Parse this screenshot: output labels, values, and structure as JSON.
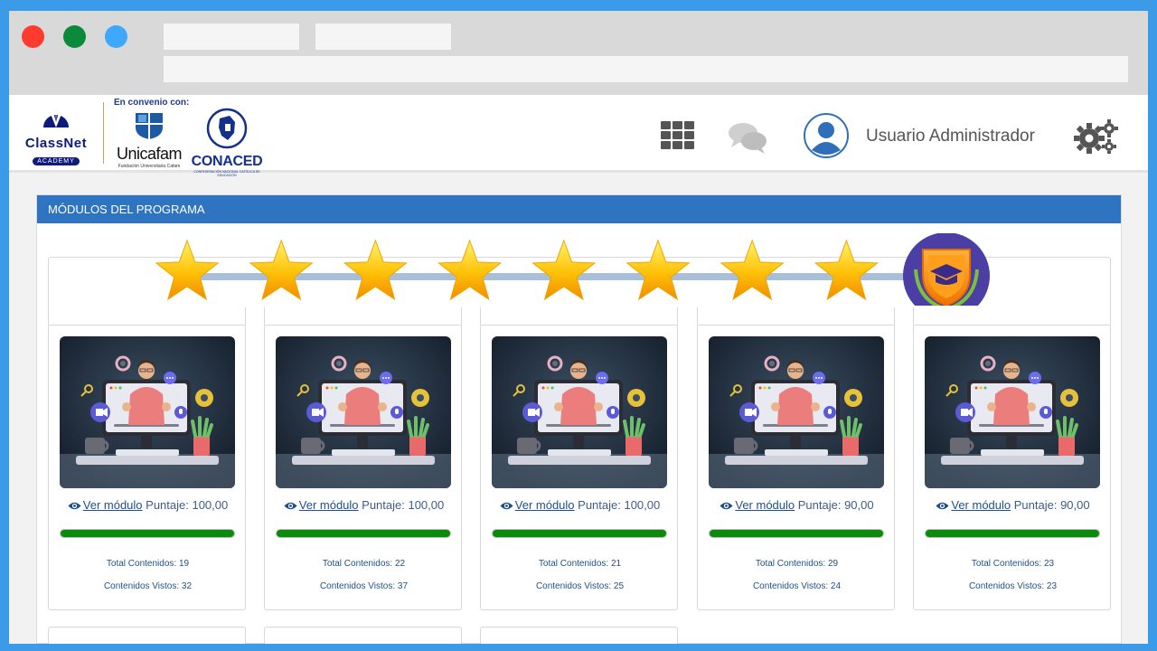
{
  "header": {
    "classnet_name": "ClassNet",
    "classnet_sub": "ACADEMY",
    "convenio": "En convenio con:",
    "unicafam_name": "Unicafam",
    "unicafam_sub": "Fundación Universitaria Cafam",
    "conaced_name": "CONACED",
    "conaced_sub": "CONFEDERACIÓN NACIONAL CATÓLICA DE EDUCACIÓN",
    "user_name": "Usuario Administrador",
    "icons": [
      "apps-grid-icon",
      "chat-icon",
      "user-avatar-icon",
      "settings-gears-icon"
    ]
  },
  "panel": {
    "title": "MÓDULOS DEL PROGRAMA",
    "progress": {
      "stars_earned": 8,
      "final_badge": "graduation-shield-icon"
    }
  },
  "colors": {
    "accent": "#2f74c0",
    "progress": "#0c8a0c",
    "link": "#1d4f91",
    "frame": "#3c9be8"
  },
  "modules": [
    {
      "link": "Ver módulo",
      "score": "Puntaje: 100,00",
      "progress": 1.0,
      "total": "Total Contenidos: 19",
      "seen": "Contenidos Vistos: 32"
    },
    {
      "link": "Ver módulo",
      "score": "Puntaje: 100,00",
      "progress": 1.0,
      "total": "Total Contenidos: 22",
      "seen": "Contenidos Vistos: 37"
    },
    {
      "link": "Ver módulo",
      "score": "Puntaje: 100,00",
      "progress": 1.0,
      "total": "Total Contenidos: 21",
      "seen": "Contenidos Vistos: 25"
    },
    {
      "link": "Ver módulo",
      "score": "Puntaje: 90,00",
      "progress": 1.0,
      "total": "Total Contenidos: 29",
      "seen": "Contenidos Vistos: 24"
    },
    {
      "link": "Ver módulo",
      "score": "Puntaje: 90,00",
      "progress": 1.0,
      "total": "Total Contenidos: 23",
      "seen": "Contenidos Vistos: 23"
    }
  ]
}
